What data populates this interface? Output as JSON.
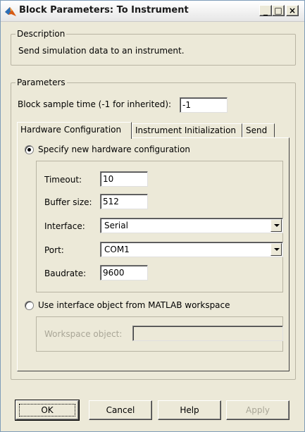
{
  "window": {
    "title": "Block Parameters: To Instrument"
  },
  "caption_buttons": {
    "minimize": "_",
    "maximize": "□",
    "close": "×"
  },
  "description": {
    "legend": "Description",
    "text": "Send simulation data to an instrument."
  },
  "parameters": {
    "legend": "Parameters",
    "sample_time_label": "Block sample time (-1 for inherited):",
    "sample_time_value": "-1"
  },
  "tabs": [
    {
      "label": "Hardware Configuration",
      "active": true
    },
    {
      "label": "Instrument Initialization",
      "active": false
    },
    {
      "label": "Send",
      "active": false
    }
  ],
  "hardware": {
    "specify_new_label": "Specify new hardware configuration",
    "specify_new_selected": true,
    "timeout_label": "Timeout:",
    "timeout_value": "10",
    "buffer_label": "Buffer size:",
    "buffer_value": "512",
    "interface_label": "Interface:",
    "interface_value": "Serial",
    "port_label": "Port:",
    "port_value": "COM1",
    "baudrate_label": "Baudrate:",
    "baudrate_value": "9600",
    "use_object_label": "Use interface object from MATLAB workspace",
    "use_object_selected": false,
    "workspace_object_label": "Workspace object:",
    "workspace_object_value": ""
  },
  "buttons": {
    "ok": "OK",
    "cancel": "Cancel",
    "help": "Help",
    "apply": "Apply"
  }
}
